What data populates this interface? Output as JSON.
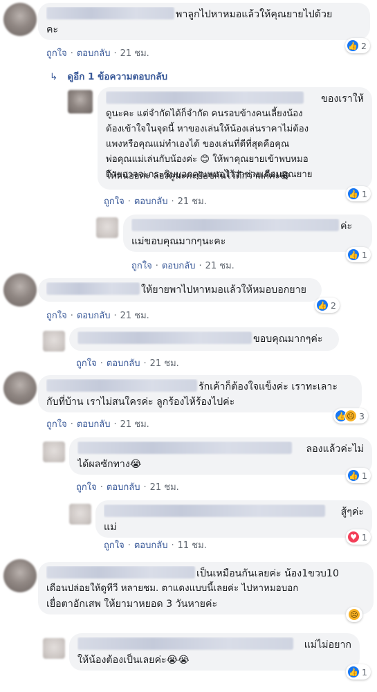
{
  "actions": {
    "like": "ถูกใจ",
    "reply": "ตอบกลับ",
    "sep": "·"
  },
  "thread": [
    {
      "text_lines": [
        "พาลูกไปหาหมอแล้วให้คุณยายไปด้วย",
        "คะ"
      ],
      "time": "21 ชม.",
      "reaction": {
        "types": [
          "like"
        ],
        "count": "2"
      },
      "replies_link": "ดูอีก 1 ข้อความตอบกลับ"
    },
    {
      "text_lines": [
        "ของเราให้",
        "ดูนะคะ แต่จำกัดได้ก็จำกัด คนรอบข้างคนเลี้ยงน้อง",
        "ต้องเข้าใจในจุดนี้ หาของเล่นให้น้องเล่นราคาไม่ต้อง",
        "แพงหรือคุณแม่ทำเองได้ ของเล่นที่ดีที่สุดคือคุณ",
        "พ่อคุณแม่เล่นกับน้องค่ะ 😊 ให้พาคุณยายเข้าพบหมอ",
        "ด้วยอาจจะกระซิบบอกคุณหมอไว้ว่าช่วยเตือนคุณยาย",
        "ให้หน่อยค่ะ ลองดูนะคะป้อขกันไว้ดีกว่าแก้ค่ะ😁"
      ],
      "time": "21 ชม.",
      "reaction": {
        "types": [
          "like"
        ],
        "count": "1"
      }
    },
    {
      "text_lines": [
        "ค่ะ",
        "แม่ขอบคุณมากๆนะคะ"
      ],
      "time": "21 ชม.",
      "reaction": {
        "types": [
          "like"
        ],
        "count": "1"
      }
    },
    {
      "text_lines": [
        "ให้ยายพาไปหาหมอแล้วให้หมอบอกยาย"
      ],
      "time": "21 ชม.",
      "reaction": {
        "types": [
          "like"
        ],
        "count": "2"
      }
    },
    {
      "text_lines": [
        "ขอบคุณมากๆค่ะ"
      ],
      "time": "21 ชม."
    },
    {
      "text_lines": [
        "รักเค้าก็ต้องใจแข็งค่ะ เราทะเลาะ",
        "กับที่บ้าน เราไม่สนใครค่ะ ลูกร้องไห้ร้องไปค่ะ"
      ],
      "time": "21 ชม.",
      "reaction": {
        "types": [
          "like",
          "sad"
        ],
        "count": "3"
      }
    },
    {
      "text_lines": [
        "ลองแล้วค่ะไม่",
        "ได้ผลซักทาง😭"
      ],
      "time": "21 ชม.",
      "reaction": {
        "types": [
          "like"
        ],
        "count": "1"
      }
    },
    {
      "text_lines": [
        "สู้ๆค่ะ",
        "แม่"
      ],
      "time": "11 ชม.",
      "reaction": {
        "types": [
          "love"
        ],
        "count": "1"
      }
    },
    {
      "text_lines": [
        "เป็นเหมือนกันเลยค่ะ น้อง1ขวบ10",
        "เดือนปล่อยให้ดูทีวี หลายชม. ตาแดงแบบนี้เลยค่ะ ไปหาหมอบอก",
        "เยื่อตาอักเสพ ให้ยามาหยอด 3 วันหายค่ะ"
      ],
      "reaction": {
        "types": [
          "sad"
        ],
        "count": ""
      }
    },
    {
      "text_lines": [
        "แม่ไม่อยาก",
        "ให้น้องต้องเป็นเลยค่ะ😭😭"
      ],
      "reaction": {
        "types": [
          "like"
        ],
        "count": "1"
      }
    }
  ],
  "icons": {
    "like": "thumbs-up-icon",
    "love": "heart-icon",
    "sad": "sad-face-icon",
    "reply_arrow": "reply-arrow-icon"
  },
  "colors": {
    "bubble": "#f2f3f5",
    "link": "#385898",
    "like": "#1877f2",
    "love": "#f33e58",
    "sad": "#f7b125"
  }
}
